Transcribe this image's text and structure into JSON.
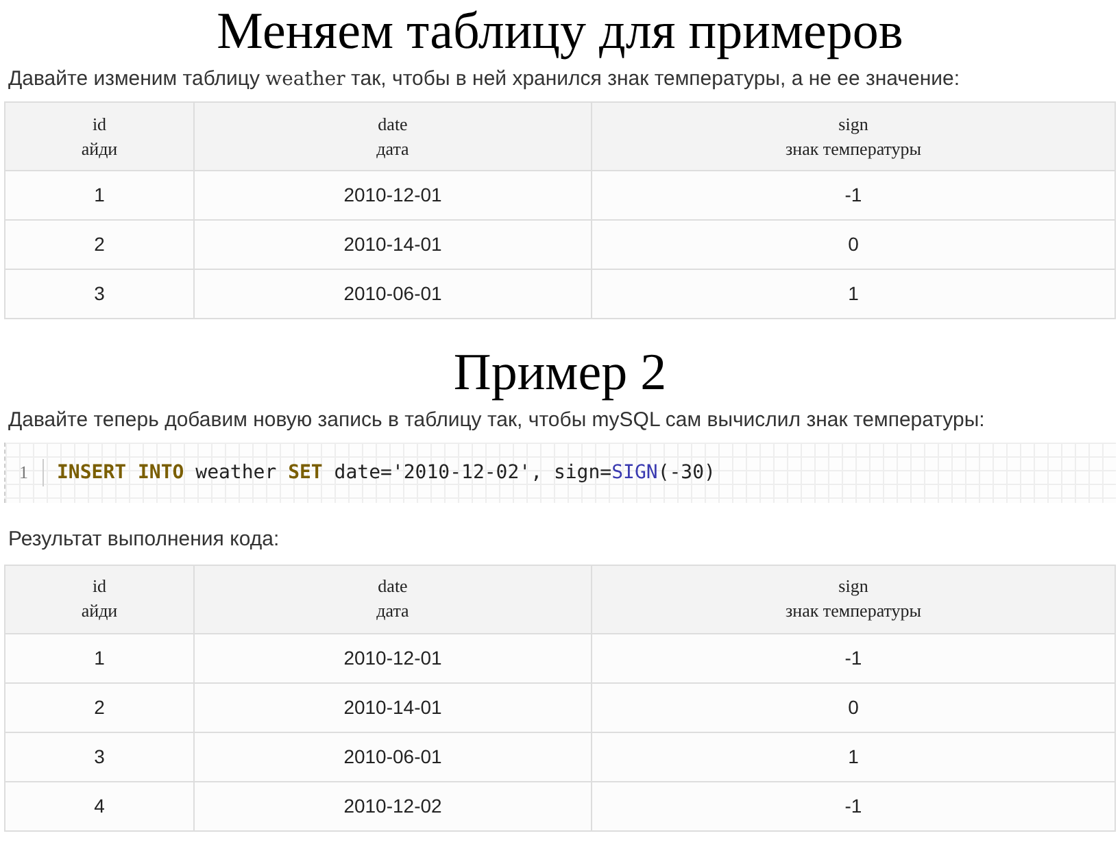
{
  "sections": [
    {
      "kind": "table_section",
      "heading": "Меняем таблицу для примеров",
      "intro": [
        {
          "kind": "plain",
          "text": "Давайте изменим таблицу "
        },
        {
          "kind": "serif",
          "text": "weather"
        },
        {
          "kind": "plain",
          "text": " так, чтобы в ней хранился знак температуры, а не ее значение:"
        }
      ],
      "table": {
        "columns": [
          "id\nайди",
          "date\nдата",
          "sign\nзнак температуры"
        ],
        "rows": [
          [
            "1",
            "2010-12-01",
            "-1"
          ],
          [
            "2",
            "2010-14-01",
            "0"
          ],
          [
            "3",
            "2010-06-01",
            "1"
          ]
        ]
      }
    },
    {
      "kind": "code_section",
      "heading": "Пример 2",
      "intro": [
        {
          "kind": "plain",
          "text": "Давайте теперь добавим новую запись в таблицу так, чтобы mySQL сам вычислил знак температуры:"
        }
      ],
      "code": {
        "line_number": "1",
        "tokens": [
          {
            "kind": "keyword",
            "text": "INSERT INTO"
          },
          {
            "kind": "plain",
            "text": " weather "
          },
          {
            "kind": "keyword",
            "text": "SET"
          },
          {
            "kind": "plain",
            "text": " date='2010-12-02', sign="
          },
          {
            "kind": "function",
            "text": "SIGN"
          },
          {
            "kind": "plain",
            "text": "(-30)"
          }
        ]
      },
      "result_label": "Результат выполнения кода:",
      "table": {
        "columns": [
          "id\nайди",
          "date\nдата",
          "sign\nзнак температуры"
        ],
        "rows": [
          [
            "1",
            "2010-12-01",
            "-1"
          ],
          [
            "2",
            "2010-14-01",
            "0"
          ],
          [
            "3",
            "2010-06-01",
            "1"
          ],
          [
            "4",
            "2010-12-02",
            "-1"
          ]
        ]
      }
    }
  ]
}
